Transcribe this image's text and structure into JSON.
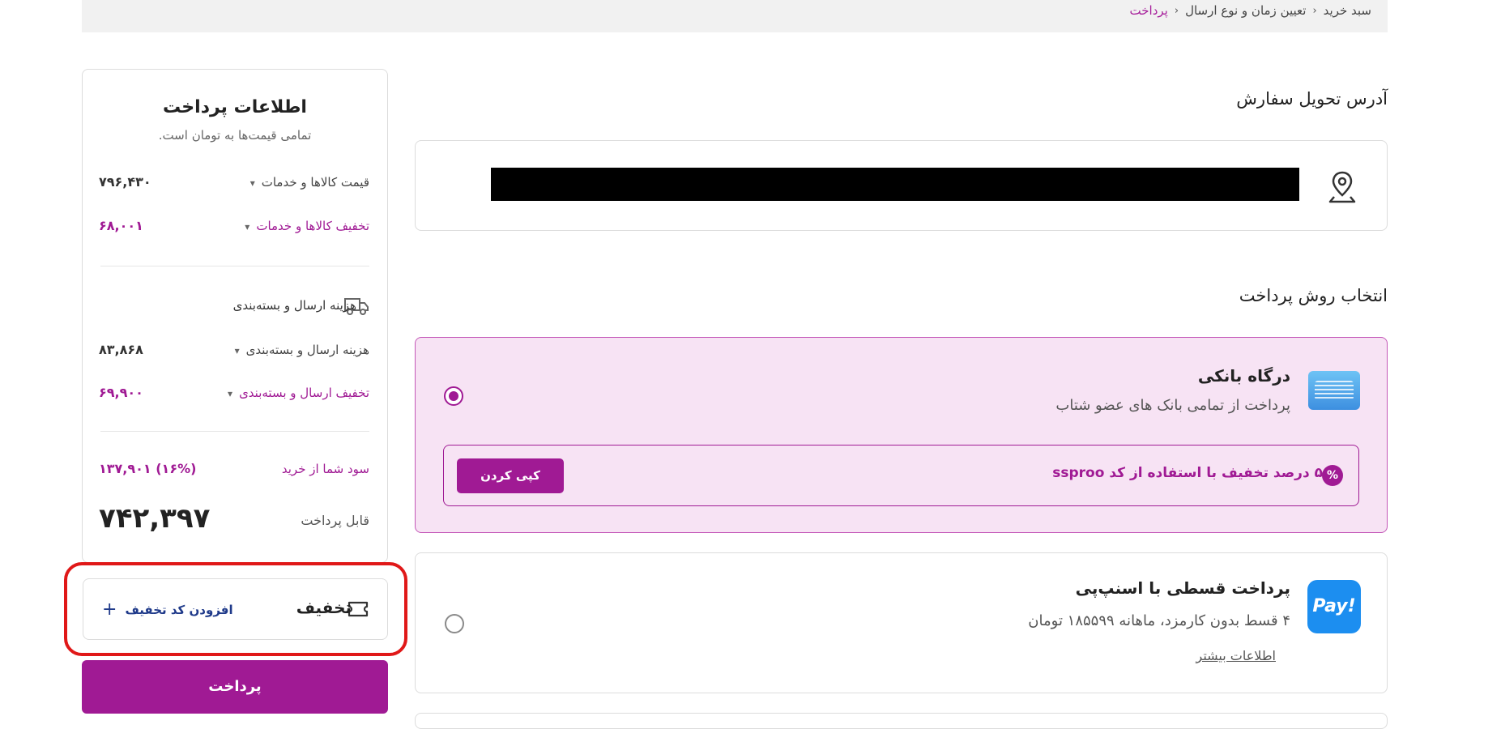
{
  "breadcrumb": {
    "items": [
      "سبد خرید",
      "تعیین زمان و نوع ارسال",
      "پرداخت"
    ]
  },
  "address": {
    "heading": "آدرس تحویل سفارش",
    "icon": "location-pin-icon"
  },
  "payment_methods": {
    "heading": "انتخاب روش پرداخت",
    "bank_gateway": {
      "title": "درگاه بانکی",
      "subtitle": "پرداخت از تمامی بانک های عضو شتاب",
      "selected": true,
      "promo": {
        "text": "۵ درصد تخفیف با استفاده از کد ssproo",
        "copy_label": "کپی کردن",
        "icon": "percent-badge-icon"
      }
    },
    "snapp_pay": {
      "title": "پرداخت قسطی با اسنپ‌پی",
      "subtitle": "۴ قسط بدون کارمزد، ماهانه ۱۸۵۵۹۹ تومان",
      "more_link": "اطلاعات بیشتر",
      "logo_text": "Pay!",
      "selected": false
    }
  },
  "summary": {
    "title": "اطلاعات پرداخت",
    "subtitle": "تمامی قیمت‌ها به تومان است.",
    "items_price": {
      "label": "قیمت کالاها و خدمات",
      "value": "۷۹۶,۴۳۰"
    },
    "items_discount": {
      "label": "تخفیف کالاها و خدمات",
      "value": "۶۸,۰۰۱"
    },
    "shipping_heading": "هزینه ارسال و بسته‌بندی",
    "shipping_cost": {
      "label": "هزینه ارسال و بسته‌بندی",
      "value": "۸۳,۸۶۸"
    },
    "shipping_discount": {
      "label": "تخفیف ارسال و بسته‌بندی",
      "value": "۶۹,۹۰۰"
    },
    "profit": {
      "label": "سود شما از خرید",
      "value": "۱۳۷,۹۰۱ (۱۶%)"
    },
    "payable": {
      "label": "قابل پرداخت",
      "value": "۷۴۲,۳۹۷"
    }
  },
  "discount": {
    "title": "تخفیف",
    "add_label": "افزودن کد تخفیف"
  },
  "pay_button": {
    "label": "پرداخت"
  },
  "colors": {
    "brand": "#a01a94",
    "highlight": "#e01818",
    "promo_bg": "#f7e3f4"
  }
}
